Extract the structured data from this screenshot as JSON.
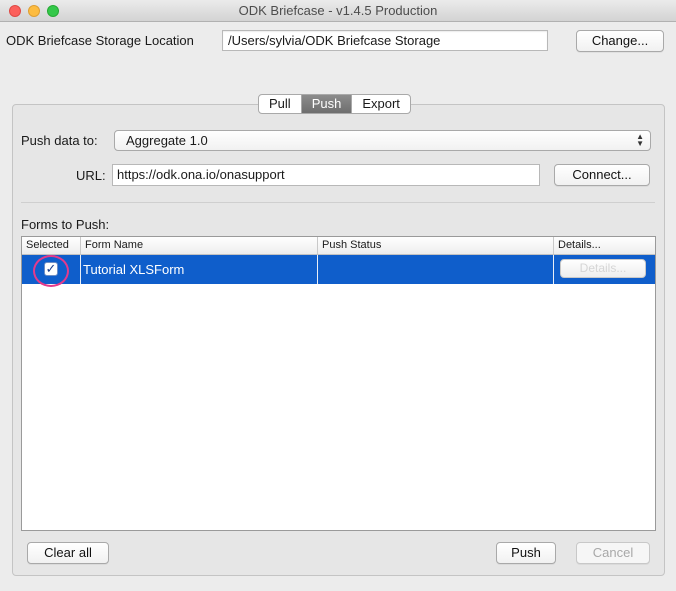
{
  "window": {
    "title": "ODK Briefcase - v1.4.5 Production"
  },
  "storage": {
    "label": "ODK Briefcase Storage Location",
    "path": "/Users/sylvia/ODK Briefcase Storage",
    "change_label": "Change..."
  },
  "tabs": [
    {
      "label": "Pull",
      "active": false
    },
    {
      "label": "Push",
      "active": true
    },
    {
      "label": "Export",
      "active": false
    }
  ],
  "push": {
    "push_to_label": "Push data to:",
    "push_to_value": "Aggregate 1.0",
    "url_label": "URL:",
    "url_value": "https://odk.ona.io/onasupport",
    "connect_label": "Connect...",
    "forms_label": "Forms to Push:"
  },
  "table": {
    "columns": [
      "Selected",
      "Form Name",
      "Push Status",
      "Details..."
    ],
    "rows": [
      {
        "selected": true,
        "form_name": "Tutorial XLSForm",
        "push_status": "",
        "details_label": "Details..."
      }
    ]
  },
  "footer": {
    "clear_all_label": "Clear all",
    "push_label": "Push",
    "cancel_label": "Cancel"
  },
  "colors": {
    "selection": "#0f5ecb",
    "highlight_circle": "#e33a8c"
  }
}
